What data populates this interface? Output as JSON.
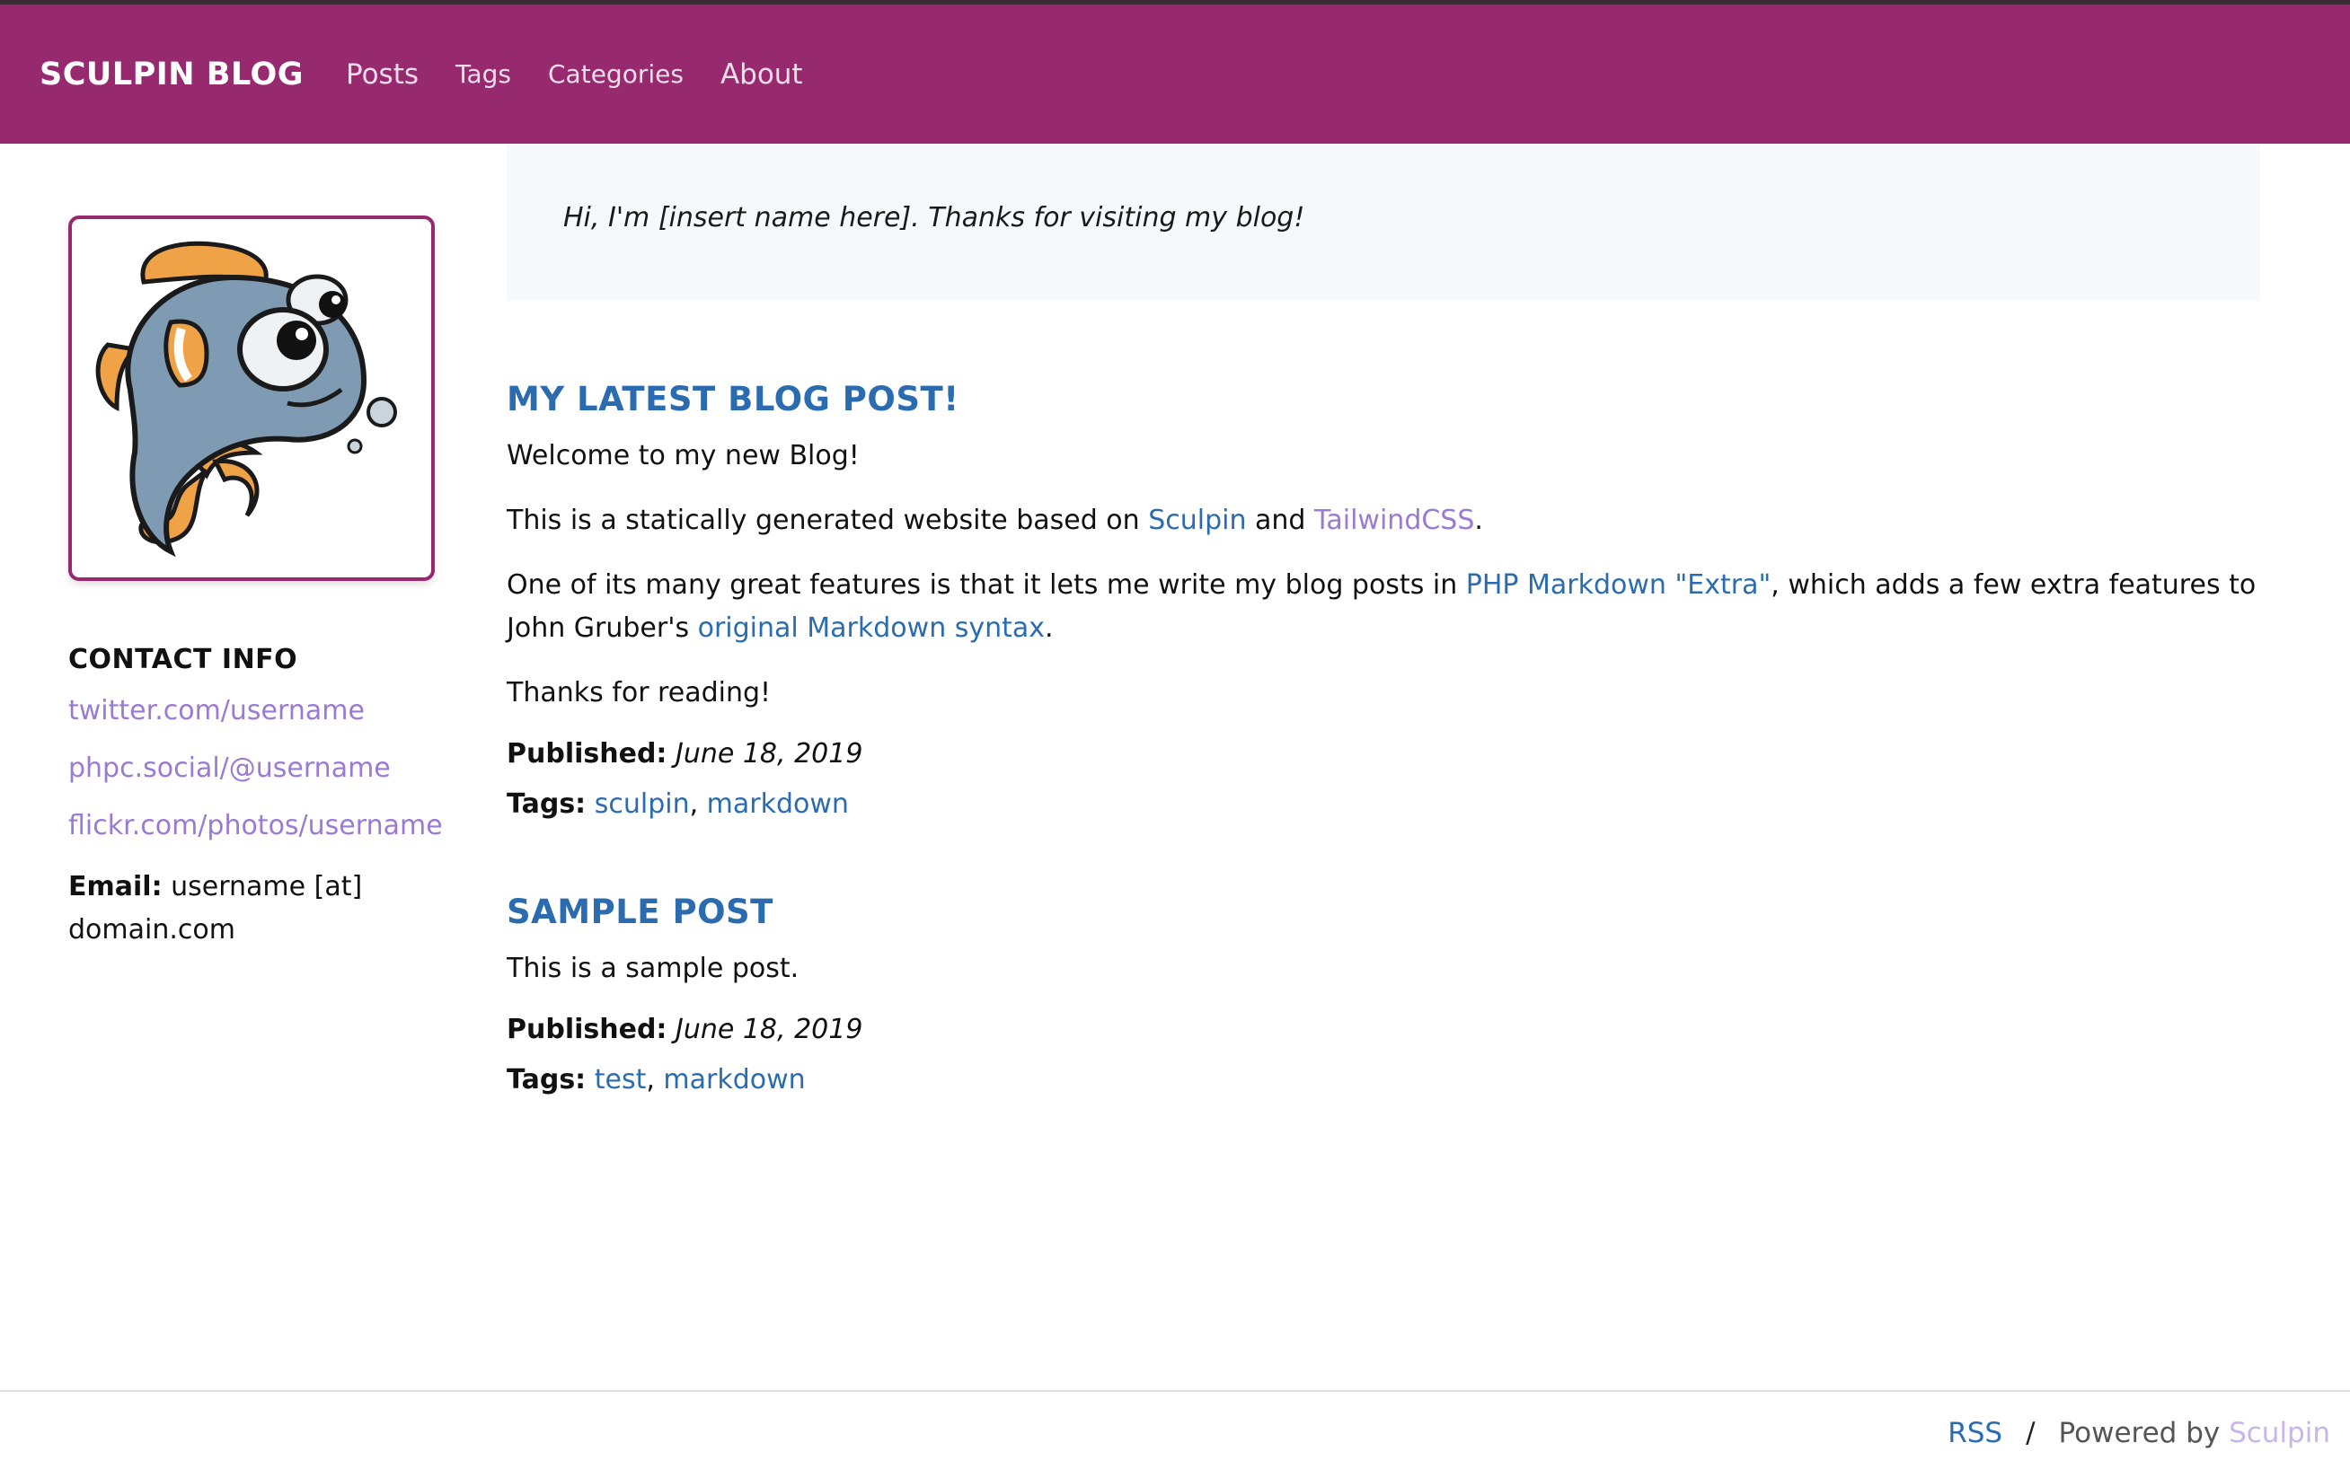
{
  "nav": {
    "brand": "SCULPIN BLOG",
    "links": [
      "Posts",
      "Tags",
      "Categories",
      "About"
    ]
  },
  "sidebar": {
    "avatar_icon": "fish-icon",
    "contact_title": "CONTACT INFO",
    "links": [
      "twitter.com/username",
      "phpc.social/@username",
      "flickr.com/photos/username"
    ],
    "email_label": "Email:",
    "email_value": "username [at] domain.com"
  },
  "intro": "Hi, I'm [insert name here]. Thanks for visiting my blog!",
  "posts": [
    {
      "title": "MY LATEST BLOG POST!",
      "p1": "Welcome to my new Blog!",
      "p2_before": "This is a statically generated website based on ",
      "p2_link1": "Sculpin",
      "p2_mid": " and ",
      "p2_link2": "TailwindCSS",
      "p2_after": ".",
      "p3_before": "One of its many great features is that it lets me write my blog posts in ",
      "p3_link1": "PHP Markdown \"Extra\"",
      "p3_mid": ", which adds a few extra features to John Gruber's ",
      "p3_link2": "original Markdown syntax",
      "p3_after": ".",
      "p4": "Thanks for reading!",
      "published_label": "Published:",
      "published_date": "June 18, 2019",
      "tags_label": "Tags:",
      "tags": [
        "sculpin",
        "markdown"
      ]
    },
    {
      "title": "SAMPLE POST",
      "p1": "This is a sample post.",
      "published_label": "Published:",
      "published_date": "June 18, 2019",
      "tags_label": "Tags:",
      "tags": [
        "test",
        "markdown"
      ]
    }
  ],
  "footer": {
    "rss": "RSS",
    "separator": "/",
    "powered_by": "Powered by ",
    "powered_link": "Sculpin"
  },
  "colors": {
    "navbar": "#97296e",
    "link_blue": "#2b6cb0",
    "link_purple": "#9a7ad3"
  }
}
